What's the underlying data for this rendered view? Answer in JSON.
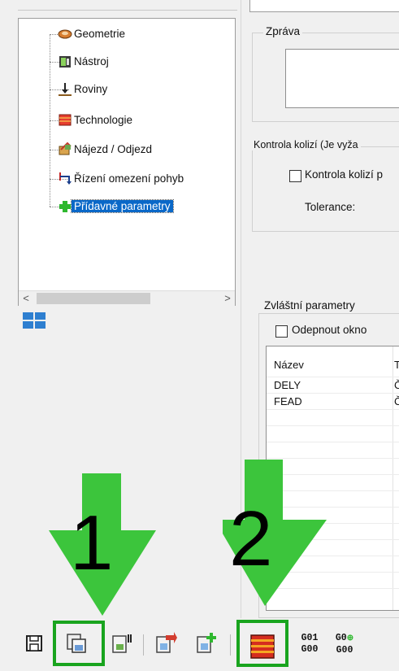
{
  "tree": {
    "items": [
      {
        "label": "Geometrie",
        "icon": "geometry-icon"
      },
      {
        "label": "Nástroj",
        "icon": "tool-icon"
      },
      {
        "label": "Roviny",
        "icon": "planes-icon"
      },
      {
        "label": "Technologie",
        "icon": "technology-icon"
      },
      {
        "label": "Nájezd / Odjezd",
        "icon": "approach-retract-icon"
      },
      {
        "label": "Řízení omezení pohyb",
        "icon": "motion-limit-icon"
      },
      {
        "label": "Přídavné parametry",
        "icon": "add-parameters-icon",
        "selected": true
      }
    ],
    "scroll_left": "<",
    "scroll_right": ">"
  },
  "message": {
    "legend": "Zpráva",
    "value": ""
  },
  "collision": {
    "legend": "Kontrola kolizí (Je vyža",
    "checkbox_label": "Kontrola kolizí p",
    "checkbox_checked": false,
    "tolerance_label": "Tolerance:"
  },
  "special_params": {
    "legend": "Zvláštní parametry",
    "undock_label": "Odepnout okno",
    "undock_checked": false,
    "columns": [
      "Název",
      "T"
    ],
    "rows": [
      [
        "DELY",
        "Č"
      ],
      [
        "FEAD",
        "Č"
      ]
    ]
  },
  "annotations": {
    "arrow1_number": "1",
    "arrow2_number": "2",
    "arrow_color": "#3cc53c",
    "highlight_color": "#19a41e"
  },
  "toolbar": {
    "buttons": [
      "save-icon",
      "save-as-icon",
      "calculator-icon",
      "export-icon",
      "add-export-icon",
      "stack-layers-icon"
    ],
    "g01_top": "G01",
    "g01_bottom": "G00",
    "g0_top": "G0",
    "g0_bottom": "G00"
  }
}
